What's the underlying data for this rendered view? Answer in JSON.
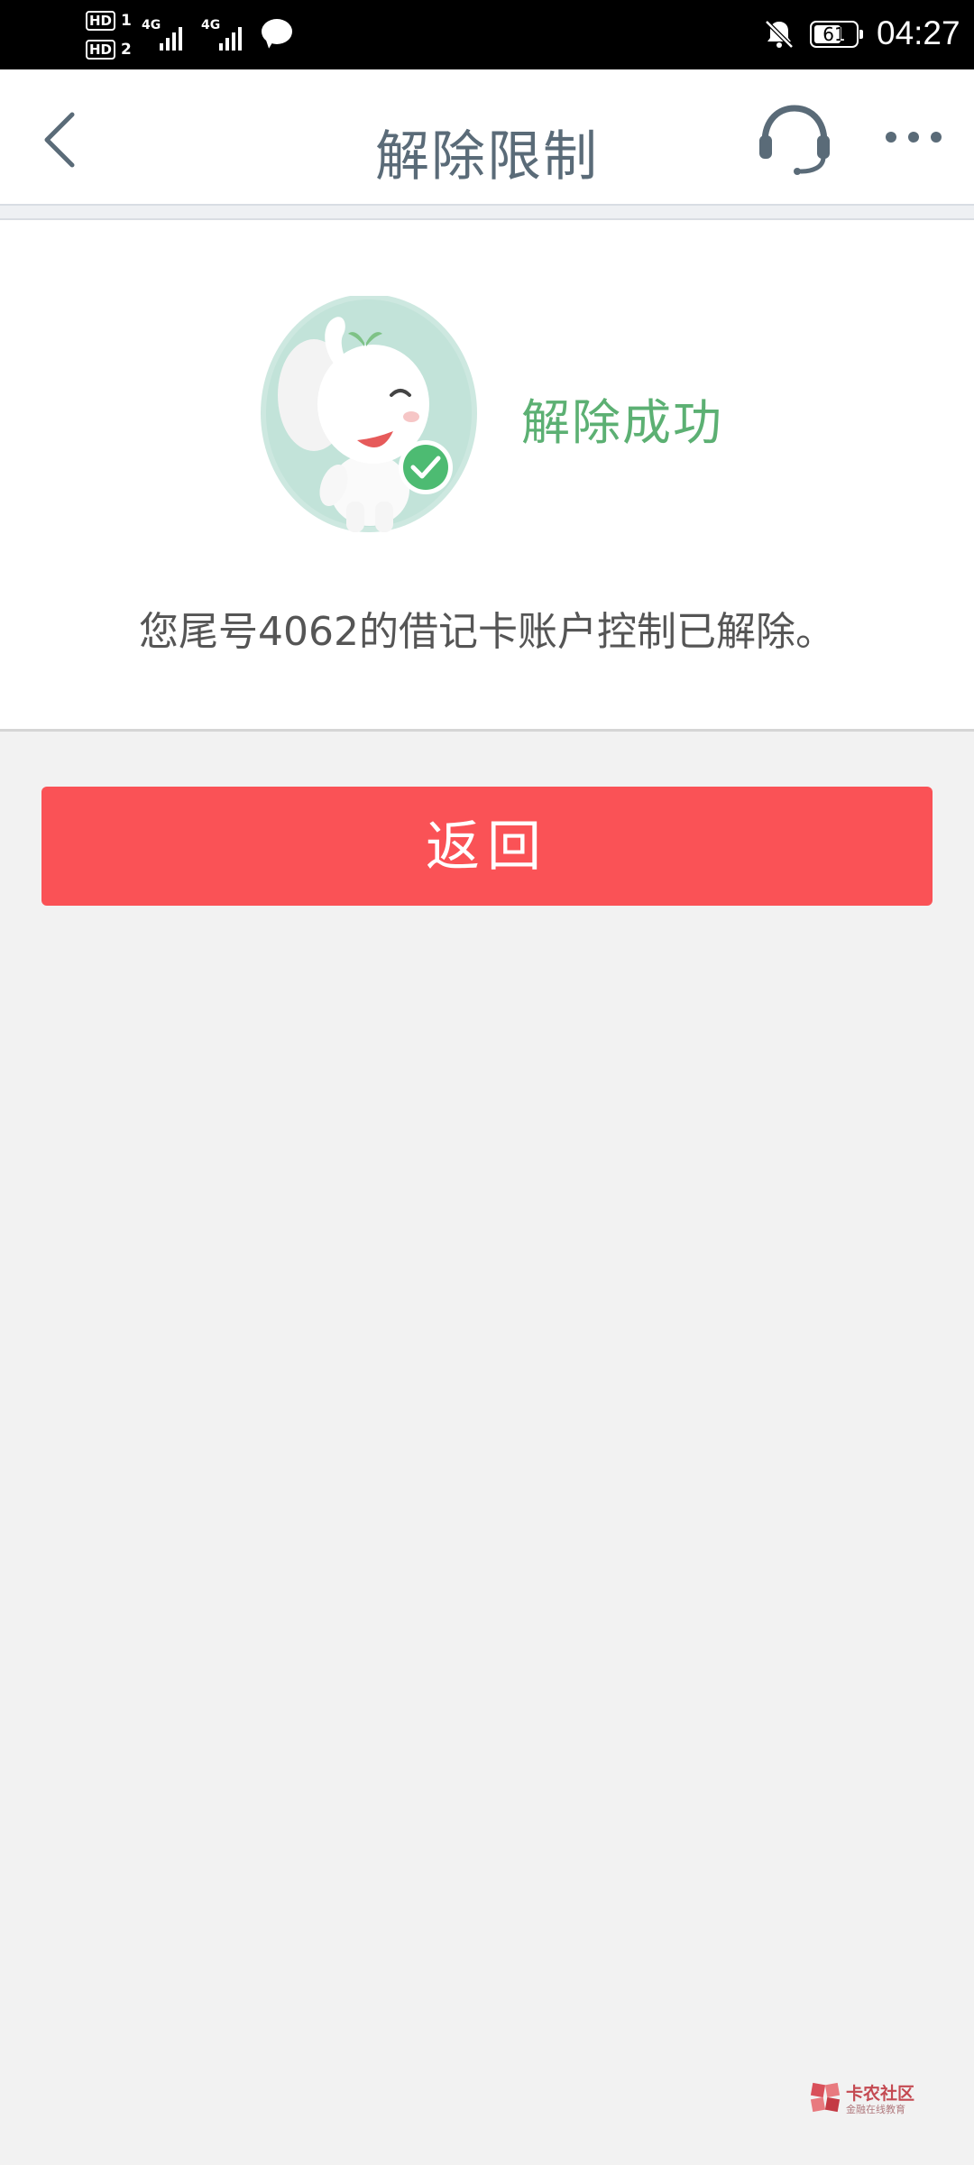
{
  "status_bar": {
    "sim1_label": "HD",
    "sim1_index": "1",
    "sim2_label": "HD",
    "sim2_index": "2",
    "network1": "4G",
    "network2": "4G",
    "battery": "61",
    "time": "04:27",
    "icons": [
      "signal-icon",
      "chat-bubble-icon",
      "bell-off-icon",
      "battery-icon"
    ]
  },
  "header": {
    "title": "解除限制",
    "back_icon": "chevron-left-icon",
    "support_icon": "headset-icon",
    "more_icon": "more-dots-icon"
  },
  "result": {
    "status_text": "解除成功",
    "message": "您尾号4062的借记卡账户控制已解除。",
    "illustration": "elephant-mascot-success"
  },
  "actions": {
    "return_label": "返回"
  },
  "watermark": {
    "title": "卡农社区",
    "subtitle": "金融在线教育"
  },
  "colors": {
    "accent_red": "#fa5256",
    "success_green": "#5cb073",
    "title_gray": "#5a6b78",
    "background": "#f2f2f2"
  }
}
